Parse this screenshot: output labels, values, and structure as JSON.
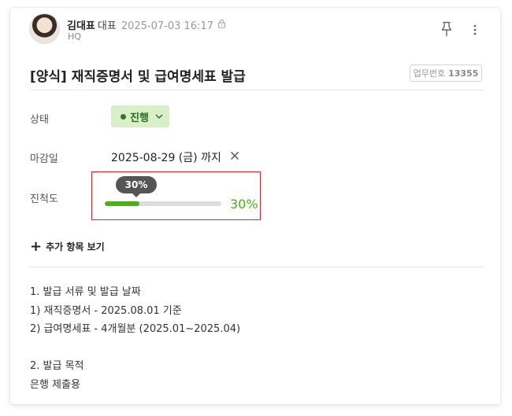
{
  "author": {
    "name": "김대표",
    "role": "대표",
    "datetime": "2025-07-03 16:17",
    "org": "HQ"
  },
  "icons": {
    "avatar": "profile-photo",
    "lock": "lock-icon",
    "pin": "pin-icon",
    "more": "more-vertical-icon",
    "status_chevron": "chevron-down-icon",
    "deadline_clear": "close-icon",
    "add": "plus-icon"
  },
  "task": {
    "title": "[양식] 재직증명서 및 급여명세표 발급",
    "number_label": "업무번호",
    "number": "13355"
  },
  "fields": {
    "status_label": "상태",
    "status_value": "진행",
    "deadline_label": "마감일",
    "deadline_value": "2025-08-29 (금) 까지",
    "progress_label": "진척도",
    "progress_tooltip": "30%",
    "progress_text": "30%",
    "progress_value": 0.3
  },
  "more_items_label": "추가 항목 보기",
  "body": {
    "line1": "1. 발급 서류 및 발급 날짜",
    "line2": "1) 재직증명서 - 2025.08.01 기준",
    "line3": "2) 급여명세표 - 4개월분 (2025.01~2025.04)",
    "line4": "",
    "line5": "2. 발급 목적",
    "line6": "은행 제출용"
  },
  "colors": {
    "status_bg": "#d8efc8",
    "status_text": "#2a6b1e",
    "progress": "#4caf1a",
    "highlight_border": "#e0232b",
    "tooltip_bg": "#555555"
  }
}
